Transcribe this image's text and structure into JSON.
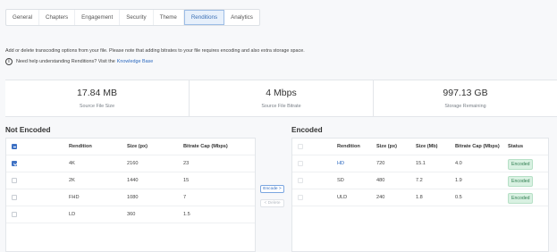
{
  "tabs": [
    {
      "label": "General",
      "active": false
    },
    {
      "label": "Chapters",
      "active": false
    },
    {
      "label": "Engagement",
      "active": false
    },
    {
      "label": "Security",
      "active": false
    },
    {
      "label": "Theme",
      "active": false
    },
    {
      "label": "Renditions",
      "active": true
    },
    {
      "label": "Analytics",
      "active": false
    }
  ],
  "info": {
    "text": "Add or delete transcoding options from your file. Please note that adding bitrates to your file requires encoding and also extra storage space.",
    "help_text": "Need help understanding Renditions? Visit the",
    "help_link": "Knowledge Base"
  },
  "stats": [
    {
      "value": "17.84 MB",
      "label": "Source File Size"
    },
    {
      "value": "4 Mbps",
      "label": "Source File Bitrate"
    },
    {
      "value": "997.13 GB",
      "label": "Storage Remaining"
    }
  ],
  "not_encoded": {
    "title": "Not Encoded",
    "columns": [
      "Rendition",
      "Size (px)",
      "Bitrate Cap (Mbps)"
    ],
    "rows": [
      {
        "rendition": "4K",
        "size": "2160",
        "bitrate": "23",
        "checked": true
      },
      {
        "rendition": "2K",
        "size": "1440",
        "bitrate": "15",
        "checked": false
      },
      {
        "rendition": "FHD",
        "size": "1080",
        "bitrate": "7",
        "checked": false
      },
      {
        "rendition": "LD",
        "size": "360",
        "bitrate": "1.5",
        "checked": false
      }
    ]
  },
  "encoded": {
    "title": "Encoded",
    "columns": [
      "Rendition",
      "Size (px)",
      "Size (Mb)",
      "Bitrate Cap (Mbps)",
      "Status"
    ],
    "rows": [
      {
        "rendition": "HD",
        "size": "720",
        "size_mb": "15.1",
        "bitrate": "4.0",
        "status": "Encoded"
      },
      {
        "rendition": "SD",
        "size": "480",
        "size_mb": "7.2",
        "bitrate": "1.9",
        "status": "Encoded"
      },
      {
        "rendition": "ULD",
        "size": "240",
        "size_mb": "1.8",
        "bitrate": "0.5",
        "status": "Encoded"
      }
    ]
  },
  "actions": {
    "encode": "Encode >",
    "delete": "< Delete"
  },
  "colors": {
    "accent": "#3f72c4",
    "arrow": "#1f6fd6",
    "encoded_badge": "#d9f1e2"
  }
}
